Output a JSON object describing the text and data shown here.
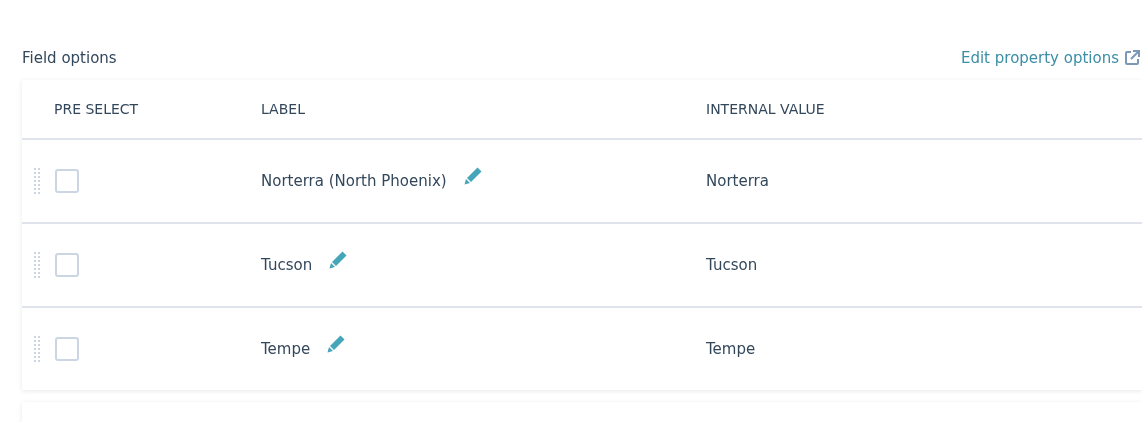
{
  "section": {
    "title": "Field options",
    "link": "Edit property options"
  },
  "table": {
    "columns": [
      "PRE SELECT",
      "LABEL",
      "INTERNAL VALUE"
    ],
    "rows": [
      {
        "checked": false,
        "label": "Norterra (North Phoenix)",
        "value": "Norterra"
      },
      {
        "checked": false,
        "label": "Tucson",
        "value": "Tucson"
      },
      {
        "checked": false,
        "label": "Tempe",
        "value": "Tempe"
      }
    ]
  }
}
